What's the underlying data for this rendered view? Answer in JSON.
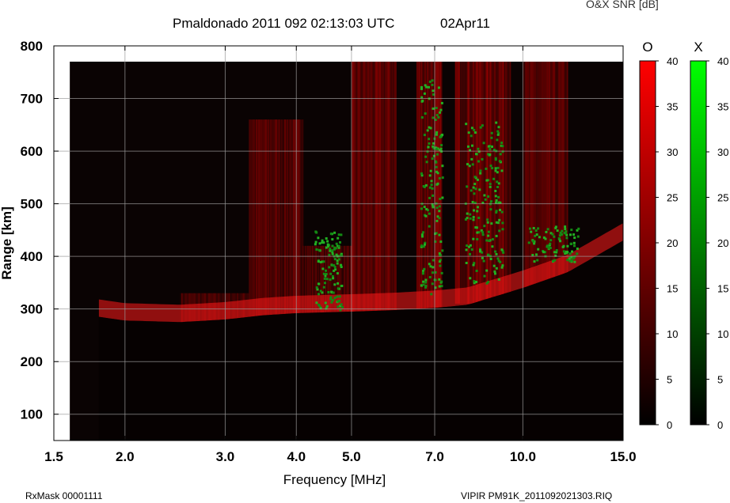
{
  "header": {
    "title": "Pmaldonado 2011 092 02:13:03 UTC",
    "date": "02Apr11",
    "snr_label": "O&X SNR [dB]"
  },
  "footer": {
    "rxmask": "RxMask 00001111",
    "file": "VIPIR  PM91K_2011092021303.RIQ"
  },
  "chart_data": {
    "type": "heatmap",
    "title": "Pmaldonado 2011 092 02:13:03 UTC",
    "xlabel": "Frequency [MHz]",
    "ylabel": "Range [km]",
    "xscale": "log",
    "xlim": [
      1.5,
      15.0
    ],
    "ylim": [
      50,
      800
    ],
    "x_ticks": [
      1.5,
      2.0,
      3.0,
      4.0,
      5.0,
      7.0,
      10.0,
      15.0
    ],
    "x_tick_labels": [
      "1.5",
      "2.0",
      "3.0",
      "4.0",
      "5.0",
      "7.0",
      "10.0",
      "15.0"
    ],
    "y_ticks": [
      100,
      200,
      300,
      400,
      500,
      600,
      700,
      800
    ],
    "y_tick_labels": [
      "100",
      "200",
      "300",
      "400",
      "500",
      "600",
      "700",
      "800"
    ],
    "data_frequency_range": [
      1.6,
      15.0
    ],
    "data_range_limit": 770,
    "colorbars": [
      {
        "name": "O",
        "color": "#ff0000",
        "min": 0,
        "max": 40,
        "ticks": [
          0,
          5,
          10,
          15,
          20,
          25,
          30,
          35,
          40
        ],
        "tick_labels": [
          "0",
          "5",
          "10",
          "15",
          "20",
          "25",
          "30",
          "35",
          "40"
        ]
      },
      {
        "name": "X",
        "color": "#00ff00",
        "min": 0,
        "max": 40,
        "ticks": [
          0,
          5,
          10,
          15,
          20,
          25,
          30,
          35,
          40
        ],
        "tick_labels": [
          "0",
          "5",
          "10",
          "15",
          "20",
          "25",
          "30",
          "35",
          "40"
        ]
      }
    ],
    "o_trace_virtual_height": [
      {
        "f": 1.8,
        "h": 285
      },
      {
        "f": 2.0,
        "h": 278
      },
      {
        "f": 2.5,
        "h": 275
      },
      {
        "f": 3.0,
        "h": 280
      },
      {
        "f": 3.5,
        "h": 288
      },
      {
        "f": 4.0,
        "h": 292
      },
      {
        "f": 5.0,
        "h": 295
      },
      {
        "f": 6.0,
        "h": 298
      },
      {
        "f": 7.0,
        "h": 302
      },
      {
        "f": 8.0,
        "h": 308
      },
      {
        "f": 10.0,
        "h": 340
      },
      {
        "f": 12.0,
        "h": 370
      },
      {
        "f": 15.0,
        "h": 430
      }
    ],
    "o_echo_bands": [
      {
        "f_start": 2.5,
        "f_end": 3.3,
        "h_min": 270,
        "h_max": 330,
        "snr": 22
      },
      {
        "f_start": 3.3,
        "f_end": 4.1,
        "h_min": 280,
        "h_max": 660,
        "snr": 28
      },
      {
        "f_start": 4.1,
        "f_end": 5.0,
        "h_min": 285,
        "h_max": 420,
        "snr": 24
      },
      {
        "f_start": 5.0,
        "f_end": 6.0,
        "h_min": 290,
        "h_max": 770,
        "snr": 30
      },
      {
        "f_start": 6.5,
        "f_end": 7.2,
        "h_min": 300,
        "h_max": 770,
        "snr": 34
      },
      {
        "f_start": 7.6,
        "f_end": 9.5,
        "h_min": 310,
        "h_max": 770,
        "snr": 36
      },
      {
        "f_start": 10.0,
        "f_end": 12.0,
        "h_min": 340,
        "h_max": 770,
        "snr": 26
      }
    ],
    "x_echo_clusters": [
      {
        "f_start": 4.3,
        "f_end": 4.8,
        "h_min": 300,
        "h_max": 450,
        "snr": 20
      },
      {
        "f_start": 6.6,
        "f_end": 7.2,
        "h_min": 330,
        "h_max": 740,
        "snr": 26
      },
      {
        "f_start": 7.9,
        "f_end": 9.2,
        "h_min": 350,
        "h_max": 660,
        "snr": 30
      },
      {
        "f_start": 10.2,
        "f_end": 12.5,
        "h_min": 390,
        "h_max": 460,
        "snr": 16
      }
    ]
  }
}
